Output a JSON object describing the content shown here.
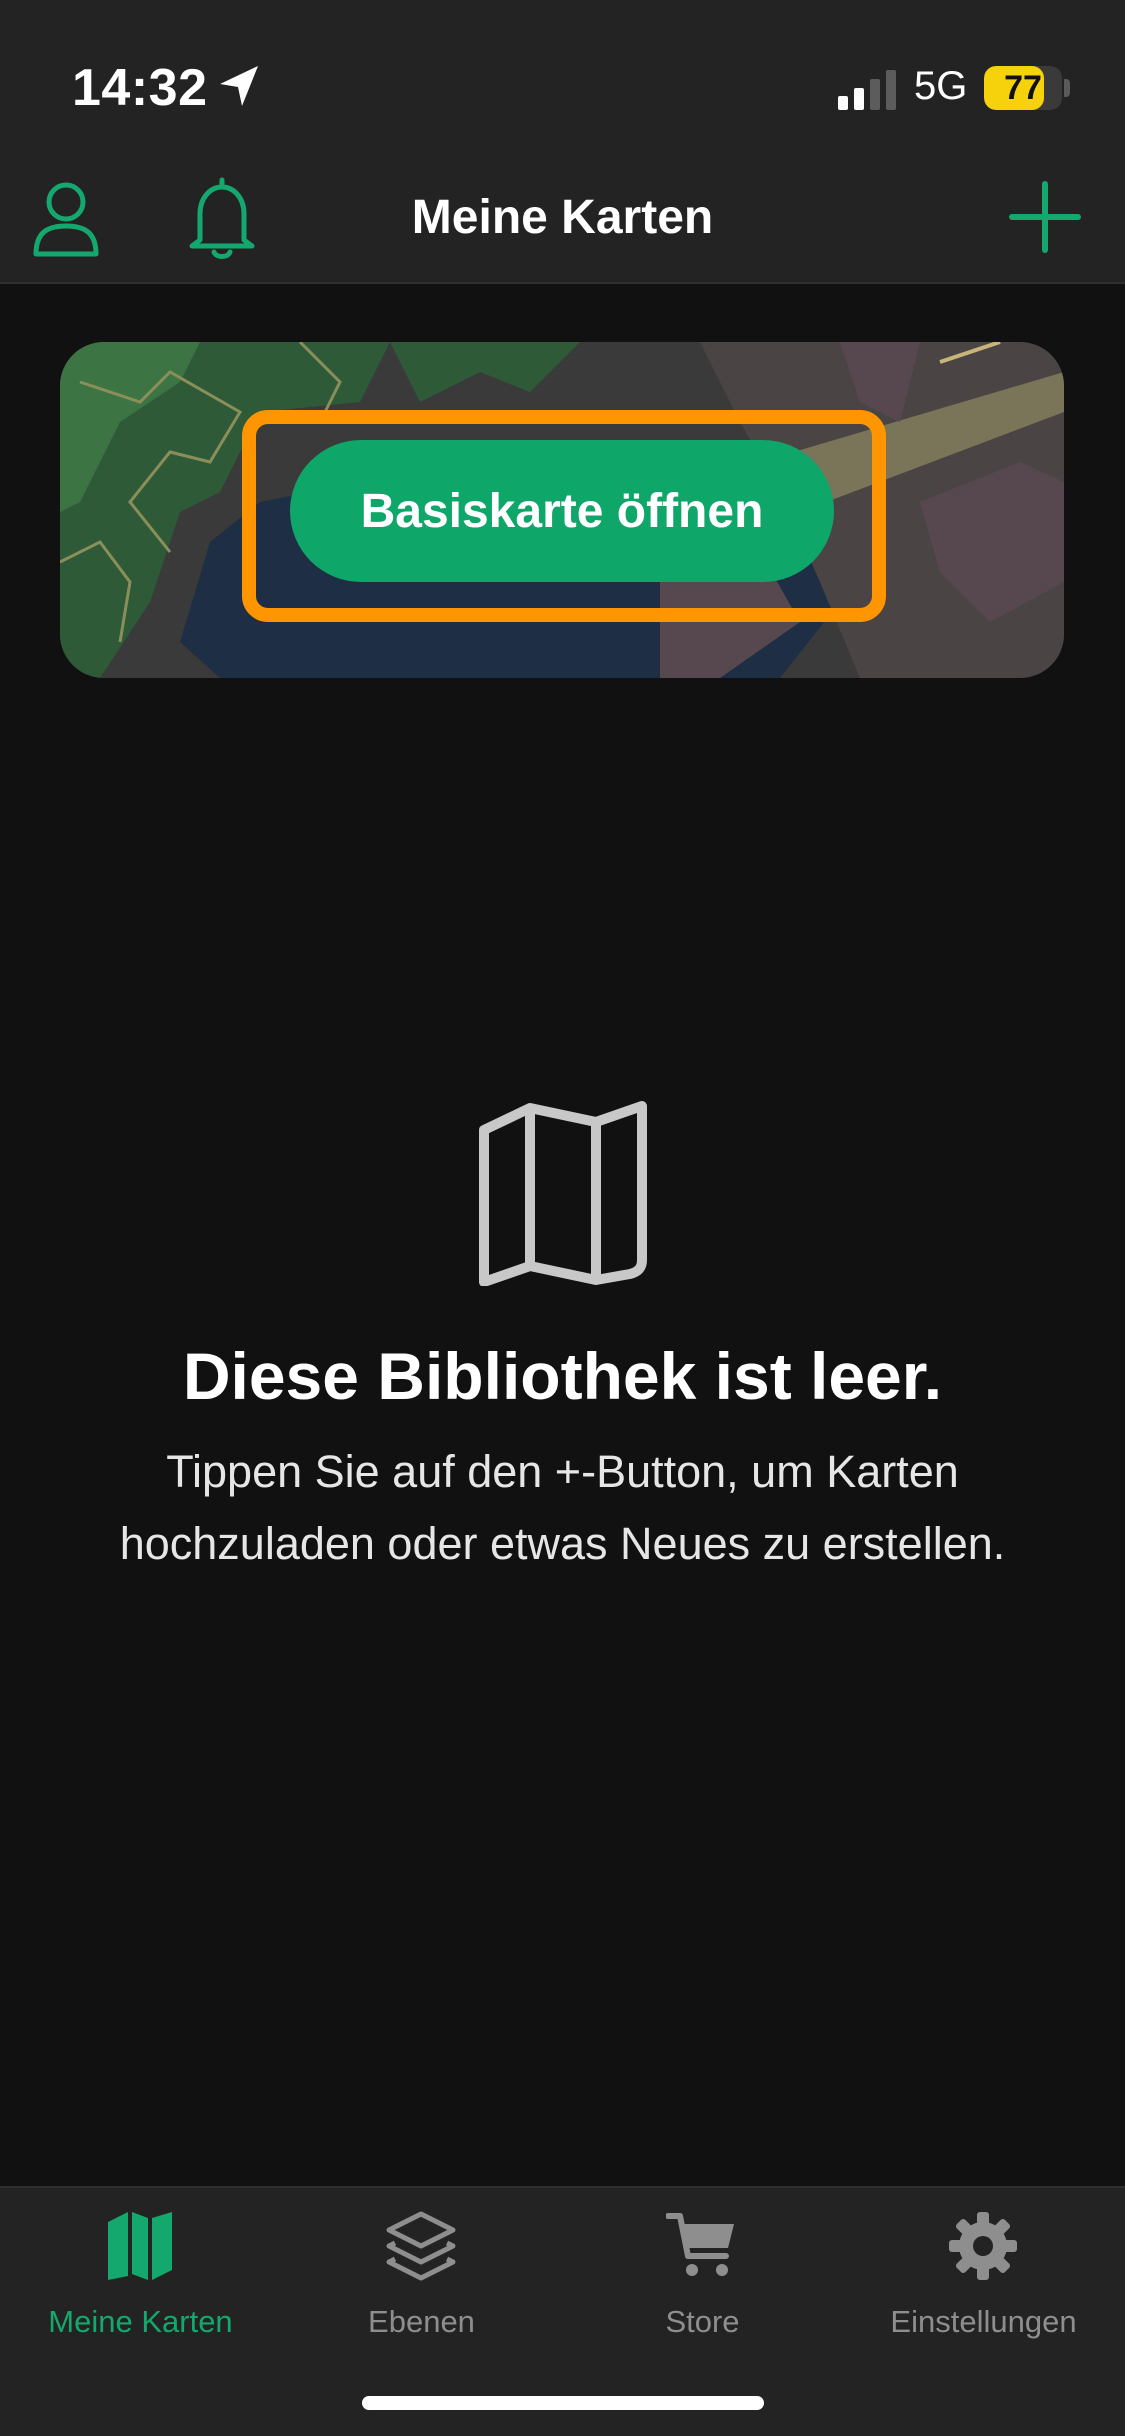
{
  "status_bar": {
    "time": "14:32",
    "network": "5G",
    "battery_level": "77",
    "battery_fraction": 0.77,
    "battery_color": "#f5d20b"
  },
  "header": {
    "title": "Meine Karten",
    "icons": [
      "profile-icon",
      "bell-icon",
      "add-icon"
    ],
    "accent_color": "#14a86e"
  },
  "banner": {
    "button_label": "Basiskarte öffnen",
    "highlight_color": "#ff9500",
    "button_color": "#0fa66a"
  },
  "empty_state": {
    "icon": "map-icon",
    "title": "Diese Bibliothek ist leer.",
    "message": "Tippen Sie auf den +-Button, um Karten hochzuladen oder etwas Neues zu erstellen."
  },
  "tabs": [
    {
      "label": "Meine Karten",
      "icon": "map-icon",
      "active": true
    },
    {
      "label": "Ebenen",
      "icon": "layers-icon",
      "active": false
    },
    {
      "label": "Store",
      "icon": "cart-icon",
      "active": false
    },
    {
      "label": "Einstellungen",
      "icon": "gear-icon",
      "active": false
    }
  ]
}
